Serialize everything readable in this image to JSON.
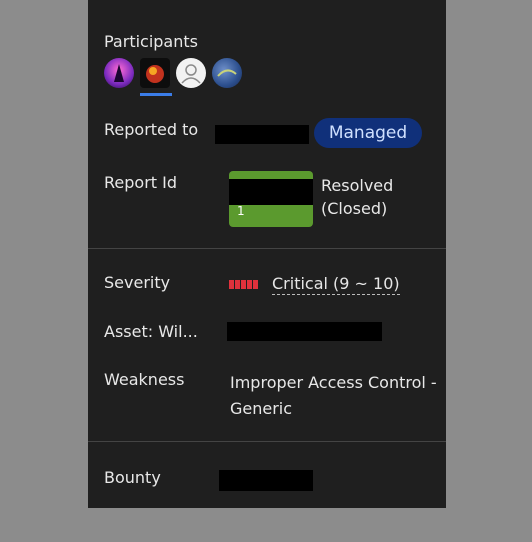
{
  "participants": {
    "label": "Participants",
    "avatars": [
      "avatar-1",
      "avatar-2",
      "avatar-3",
      "avatar-4"
    ]
  },
  "reported_to": {
    "label": "Reported to",
    "badge": "Managed"
  },
  "report_id": {
    "label": "Report Id",
    "number": "1",
    "status": "Resolved\n(Closed)"
  },
  "severity": {
    "label": "Severity",
    "value": "Critical (9 ~ 10)",
    "color": "#e0313c"
  },
  "asset": {
    "label": "Asset: Wil..."
  },
  "weakness": {
    "label": "Weakness",
    "value": "Improper Access Control - Generic"
  },
  "bounty": {
    "label": "Bounty"
  }
}
